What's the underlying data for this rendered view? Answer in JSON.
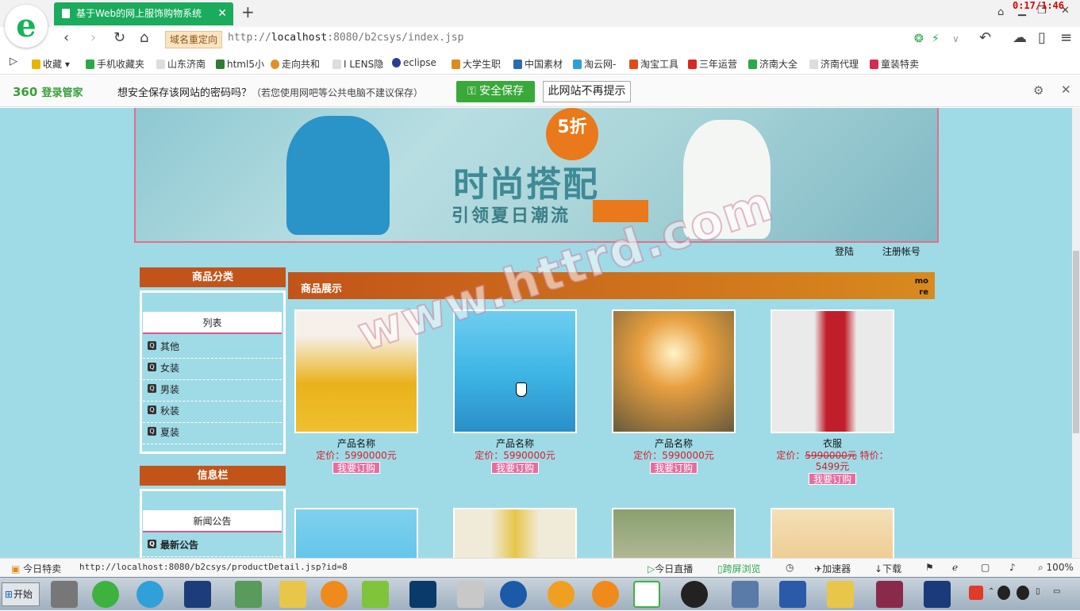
{
  "browser": {
    "tab_title": "基于Web的网上服饰购物系统",
    "tab_close": "✕",
    "new_tab": "+",
    "clock": "0:17/1:46",
    "redirect_label": "域名重定向",
    "url_prefix": "http://",
    "url_host": "localhost",
    "url_rest": ":8080/b2csys/index.jsp"
  },
  "bookmarks": [
    {
      "label": "收藏",
      "color": "#e8b400"
    },
    {
      "label": "手机收藏夹",
      "color": "#2aa84a"
    },
    {
      "label": "山东济南",
      "color": "#cccccc"
    },
    {
      "label": "html5小",
      "color": "#2e7d32"
    },
    {
      "label": "走向共和",
      "color": "#e0902a"
    },
    {
      "label": "I LENS隐",
      "color": "#cccccc"
    },
    {
      "label": "eclipse",
      "color": "#2c3f8f"
    },
    {
      "label": "大学生职",
      "color": "#e08a1b"
    },
    {
      "label": "中国素材",
      "color": "#2b6cb0"
    },
    {
      "label": "淘云网-",
      "color": "#2ea0d8"
    },
    {
      "label": "淘宝工具",
      "color": "#e34b16"
    },
    {
      "label": "三年运营",
      "color": "#d9281e"
    },
    {
      "label": "济南大全",
      "color": "#2aa84a"
    },
    {
      "label": "济南代理",
      "color": "#cccccc"
    },
    {
      "label": "童装特卖",
      "color": "#d8284f"
    }
  ],
  "password_bar": {
    "brand": "360",
    "brand_sub": "登录管家",
    "question": "想安全保存该网站的密码吗？",
    "hint": "（若您使用网吧等公共电脑不建议保存）",
    "save_label": "安全保存",
    "dismiss_label": "此网站不再提示"
  },
  "banner": {
    "badge": "5折",
    "title": "时尚搭配",
    "subtitle": "引领夏日潮流"
  },
  "top_links": {
    "login": "登陆",
    "register": "注册帐号"
  },
  "sidebar": {
    "category_title": "商品分类",
    "list_label": "列表",
    "categories": [
      "其他",
      "女装",
      "男装",
      "秋装",
      "夏装"
    ],
    "info_title": "信息栏",
    "news_label": "新闻公告",
    "news_items": [
      "最新公告"
    ]
  },
  "products": {
    "section_title": "商品展示",
    "more": "more",
    "items": [
      {
        "name": "产品名称",
        "price": "定价：5990000元",
        "buy": "我要订购",
        "colors": [
          "#f5f1ea",
          "#e9b21b"
        ]
      },
      {
        "name": "产品名称",
        "price": "定价：5990000元",
        "buy": "我要订购",
        "colors": [
          "#3fb6e6",
          "#5cc6e8"
        ]
      },
      {
        "name": "产品名称",
        "price": "定价：5990000元",
        "buy": "我要订购",
        "colors": [
          "#e8a040",
          "#6a5a3a"
        ]
      },
      {
        "name": "衣服",
        "price_label": "定价：",
        "old_price": "5990000元",
        "special": " 特价：5499元",
        "buy": "我要订购",
        "colors": [
          "#eaeaea",
          "#c01e2a"
        ]
      }
    ],
    "row2_colors": [
      [
        "#3fb6e6",
        "#7fd0ee"
      ],
      [
        "#f0ead8",
        "#e6c64a"
      ],
      [
        "#8aa070",
        "#e8d8c8"
      ],
      [
        "#f4e0b8",
        "#e8b060"
      ]
    ]
  },
  "watermark": "www.httrd.com",
  "status": {
    "today_sale": "今日特卖",
    "link_url": "http://localhost:8080/b2csys/productDetail.jsp?id=8",
    "live": "今日直播",
    "cross_screen": "跨屏浏览",
    "accelerator": "加速器",
    "download": "下载",
    "zoom": "100%"
  },
  "taskbar": {
    "start": "开始"
  }
}
